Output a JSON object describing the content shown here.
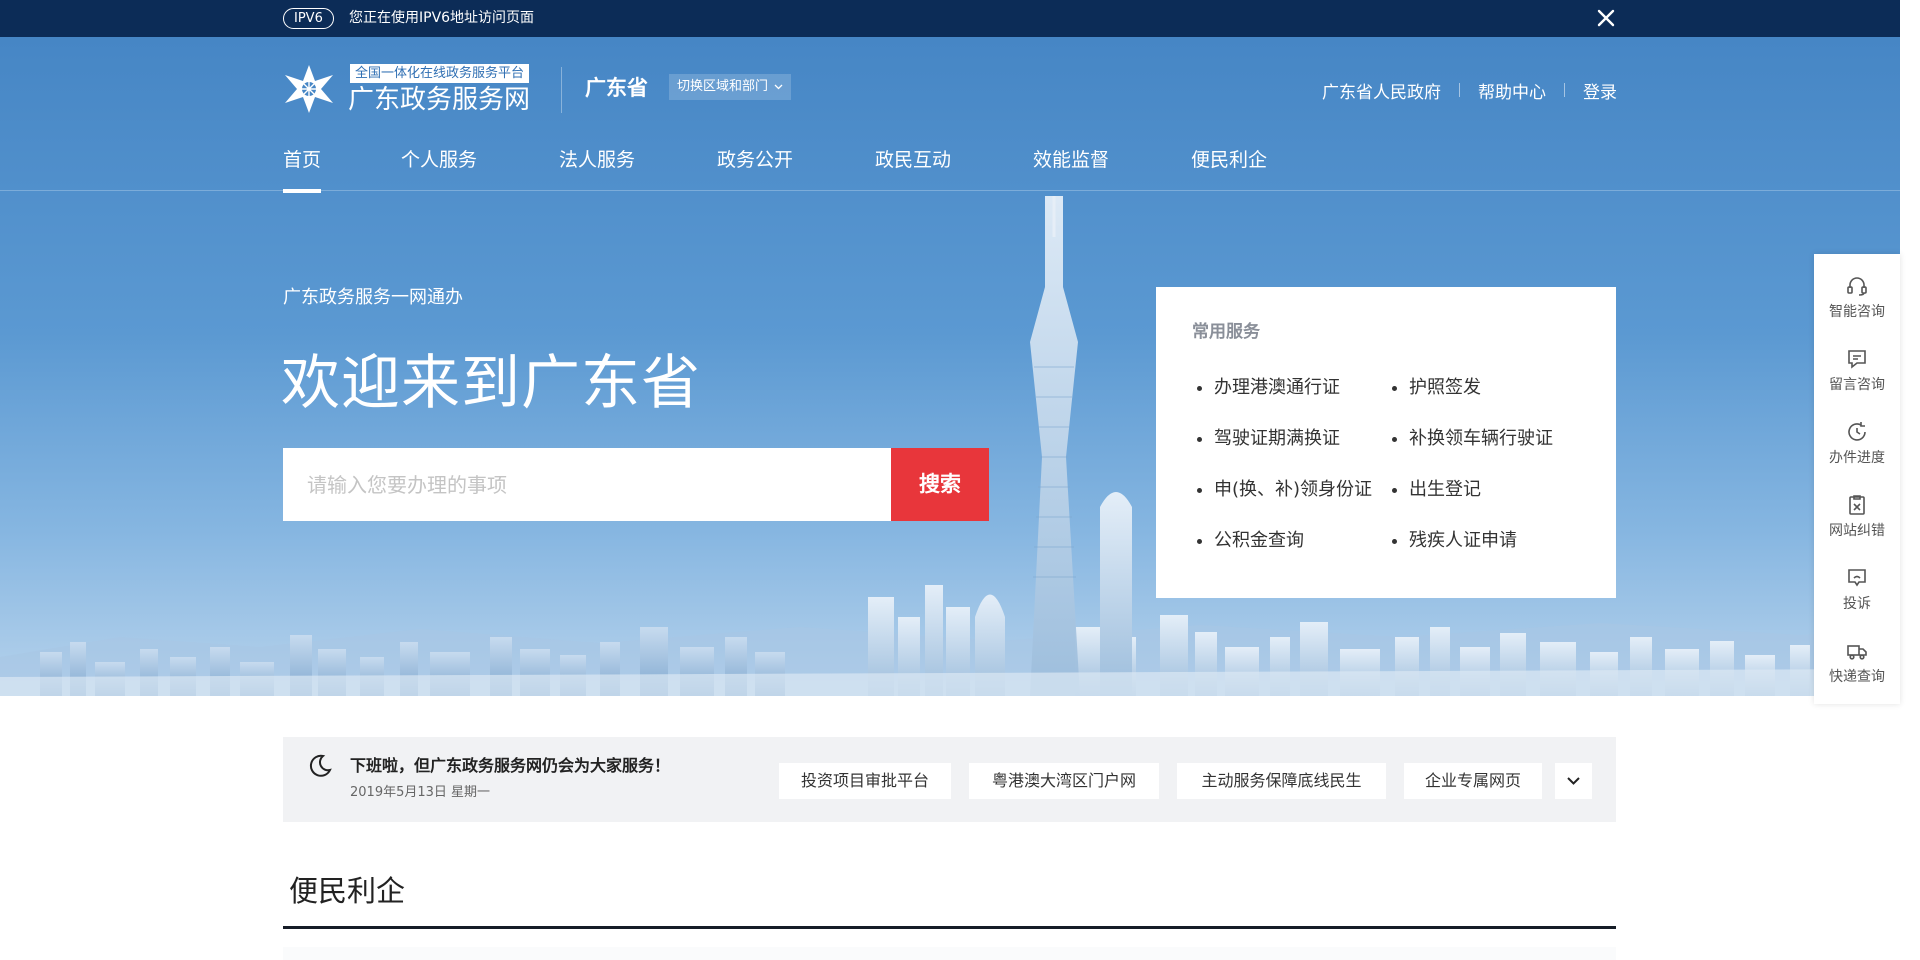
{
  "ipv6_bar": {
    "badge": "IPV6",
    "message": "您正在使用IPV6地址访问页面"
  },
  "header": {
    "logo_tag": "全国一体化在线政务服务平台",
    "logo_name": "广东政务服务网",
    "region_name": "广东省",
    "region_switch": "切换区域和部门",
    "links": [
      "广东省人民政府",
      "帮助中心",
      "登录"
    ]
  },
  "nav": {
    "items": [
      "首页",
      "个人服务",
      "法人服务",
      "政务公开",
      "政民互动",
      "效能监督",
      "便民利企"
    ],
    "active_index": 0
  },
  "hero": {
    "subtitle": "广东政务服务一网通办",
    "title": "欢迎来到广东省"
  },
  "search": {
    "placeholder": "请输入您要办理的事项",
    "value": "",
    "button_label": "搜索"
  },
  "common_services": {
    "title": "常用服务",
    "items": [
      "办理港澳通行证",
      "护照签发",
      "驾驶证期满换证",
      "补换领车辆行驶证",
      "申(换、补)领身份证",
      "出生登记",
      "公积金查询",
      "残疾人证申请"
    ]
  },
  "side_toolbar": {
    "items": [
      {
        "label": "智能咨询",
        "icon": "headset-icon"
      },
      {
        "label": "留言咨询",
        "icon": "message-icon"
      },
      {
        "label": "办件进度",
        "icon": "progress-icon"
      },
      {
        "label": "网站纠错",
        "icon": "error-report-icon"
      },
      {
        "label": "投诉",
        "icon": "complaint-icon"
      },
      {
        "label": "快递查询",
        "icon": "delivery-truck-icon"
      }
    ]
  },
  "notice": {
    "message": "下班啦，但广东政务服务网仍会为大家服务！",
    "date": "2019年5月13日 星期一",
    "quick_links": [
      "投资项目审批平台",
      "粤港澳大湾区门户网",
      "主动服务保障底线民生",
      "企业专属网页"
    ]
  },
  "section": {
    "title": "便民利企"
  },
  "colors": {
    "top_bar": "#0c2c57",
    "hero_blue": "#4686c5",
    "search_button": "#e8363b",
    "notice_bg": "#f1f2f4"
  }
}
